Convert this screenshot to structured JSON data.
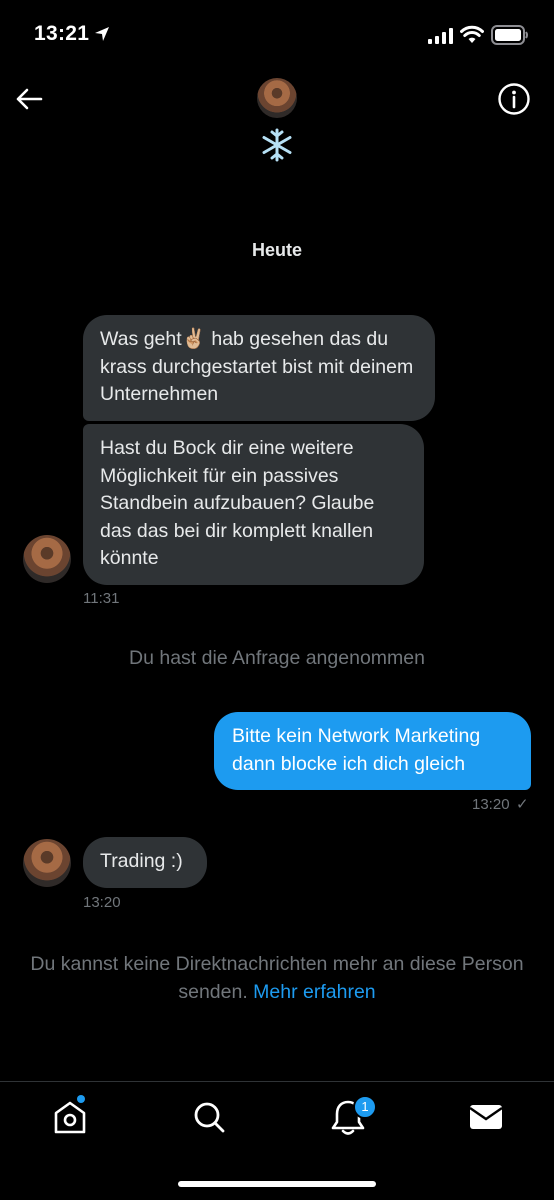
{
  "status_bar": {
    "time": "13:21"
  },
  "day_separator": "Heute",
  "messages": [
    {
      "text": "Was geht✌🏼 hab gesehen das du krass durchgestartet bist mit deinem Unternehmen"
    },
    {
      "text": "Hast du Bock dir eine weitere Möglichkeit für ein passives Standbein aufzubauen? Glaube das das bei dir komplett knallen könnte",
      "time": "11:31"
    },
    {
      "text": "Bitte kein Network Marketing dann blocke ich dich gleich",
      "time": "13:20"
    },
    {
      "text": "Trading :)",
      "time": "13:20"
    }
  ],
  "system_message": "Du hast die Anfrage angenommen",
  "notice": {
    "text": "Du kannst keine Direktnachrichten mehr an diese Person senden.",
    "link": "Mehr erfahren"
  },
  "tabs": {
    "notifications_badge": "1"
  },
  "colors": {
    "accent": "#1d9bf0",
    "incoming_bubble": "#2f3336",
    "background": "#000000"
  },
  "icons": [
    "location-arrow-icon",
    "signal-icon",
    "wifi-icon",
    "battery-icon",
    "back-arrow-icon",
    "snowflake-icon",
    "info-icon",
    "home-icon",
    "search-icon",
    "bell-icon",
    "mail-icon"
  ]
}
